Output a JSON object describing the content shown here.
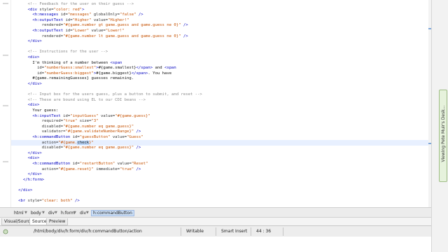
{
  "editor": {
    "lines": [
      {
        "segments": [
          {
            "t": "comment",
            "v": "<!-- Feedback for the user on their guess -->"
          }
        ],
        "indent": 7
      },
      {
        "segments": [
          {
            "t": "tag",
            "v": "<div"
          },
          {
            "t": "attr",
            "v": " style="
          },
          {
            "t": "str",
            "v": "\"color: red\""
          },
          {
            "t": "tag",
            "v": ">"
          }
        ],
        "indent": 7
      },
      {
        "segments": [
          {
            "t": "tag",
            "v": "<h:messages"
          },
          {
            "t": "attr",
            "v": " id="
          },
          {
            "t": "str",
            "v": "\"messages\""
          },
          {
            "t": "attr",
            "v": " globalOnly="
          },
          {
            "t": "str",
            "v": "\"false\""
          },
          {
            "t": "tag",
            "v": " />"
          }
        ],
        "indent": 9
      },
      {
        "segments": [
          {
            "t": "tag",
            "v": "<h:outputText"
          },
          {
            "t": "attr",
            "v": " id="
          },
          {
            "t": "str",
            "v": "\"Higher\""
          },
          {
            "t": "attr",
            "v": " value="
          },
          {
            "t": "str",
            "v": "\"Higher!\""
          }
        ],
        "indent": 9
      },
      {
        "segments": [
          {
            "t": "attr",
            "v": "rendered="
          },
          {
            "t": "str",
            "v": "\"#{game.number gt game.guess and game.guess ne 0}\""
          },
          {
            "t": "tag",
            "v": " />"
          }
        ],
        "indent": 13
      },
      {
        "segments": [
          {
            "t": "tag",
            "v": "<h:outputText"
          },
          {
            "t": "attr",
            "v": " id="
          },
          {
            "t": "str",
            "v": "\"Lower\""
          },
          {
            "t": "attr",
            "v": " value="
          },
          {
            "t": "str",
            "v": "\"Lower!\""
          }
        ],
        "indent": 9
      },
      {
        "segments": [
          {
            "t": "attr",
            "v": "rendered="
          },
          {
            "t": "str",
            "v": "\"#{game.number lt game.guess and game.guess ne 0}\""
          },
          {
            "t": "tag",
            "v": " />"
          }
        ],
        "indent": 13
      },
      {
        "segments": [
          {
            "t": "tag",
            "v": "</div>"
          }
        ],
        "indent": 7
      },
      {
        "segments": [],
        "indent": 0
      },
      {
        "segments": [
          {
            "t": "comment",
            "v": "<!-- Instructions for the user -->"
          }
        ],
        "indent": 7
      },
      {
        "segments": [
          {
            "t": "tag",
            "v": "<div>"
          }
        ],
        "indent": 7
      },
      {
        "segments": [
          {
            "t": "text",
            "v": "I'm thinking of a number between "
          },
          {
            "t": "tag",
            "v": "<span"
          }
        ],
        "indent": 9
      },
      {
        "segments": [
          {
            "t": "attr",
            "v": "id="
          },
          {
            "t": "str",
            "v": "\"numberGuess:smallest\""
          },
          {
            "t": "tag",
            "v": ">"
          },
          {
            "t": "text",
            "v": "#{game.smallest}"
          },
          {
            "t": "tag",
            "v": "</span>"
          },
          {
            "t": "text",
            "v": " and "
          },
          {
            "t": "tag",
            "v": "<span"
          }
        ],
        "indent": 11
      },
      {
        "segments": [
          {
            "t": "attr",
            "v": "id="
          },
          {
            "t": "str",
            "v": "\"numberGuess:biggest\""
          },
          {
            "t": "tag",
            "v": ">"
          },
          {
            "t": "text",
            "v": "#{game.biggest}"
          },
          {
            "t": "tag",
            "v": "</span>"
          },
          {
            "t": "text",
            "v": ". You have"
          }
        ],
        "indent": 11
      },
      {
        "segments": [
          {
            "t": "text",
            "v": "#{game.remainingGuesses} guesses remaining."
          }
        ],
        "indent": 9
      },
      {
        "segments": [
          {
            "t": "tag",
            "v": "</div>"
          }
        ],
        "indent": 7
      },
      {
        "segments": [],
        "indent": 0
      },
      {
        "segments": [
          {
            "t": "comment",
            "v": "<!-- Input box for the users guess, plus a button to submit, and reset -->"
          }
        ],
        "indent": 7
      },
      {
        "segments": [
          {
            "t": "comment",
            "v": "<!-- These are bound using EL to our CDI beans -->"
          }
        ],
        "indent": 7
      },
      {
        "segments": [
          {
            "t": "tag",
            "v": "<div>"
          }
        ],
        "indent": 7
      },
      {
        "segments": [
          {
            "t": "text",
            "v": "Your guess:"
          }
        ],
        "indent": 9
      },
      {
        "segments": [
          {
            "t": "tag",
            "v": "<h:inputText"
          },
          {
            "t": "attr",
            "v": " id="
          },
          {
            "t": "str",
            "v": "\"inputGuess\""
          },
          {
            "t": "attr",
            "v": " value="
          },
          {
            "t": "str",
            "v": "\"#{game.guess}\""
          }
        ],
        "indent": 9
      },
      {
        "segments": [
          {
            "t": "attr",
            "v": "required="
          },
          {
            "t": "str",
            "v": "\"true\""
          },
          {
            "t": "attr",
            "v": " size="
          },
          {
            "t": "str",
            "v": "\"3\""
          }
        ],
        "indent": 13
      },
      {
        "segments": [
          {
            "t": "attr",
            "v": "disabled="
          },
          {
            "t": "str",
            "v": "\"#{game.number eq game.guess}\""
          }
        ],
        "indent": 13
      },
      {
        "segments": [
          {
            "t": "attr",
            "v": "validator="
          },
          {
            "t": "str",
            "v": "\"#{game.validateNumberRange}\""
          },
          {
            "t": "tag",
            "v": " />"
          }
        ],
        "indent": 13
      },
      {
        "segments": [
          {
            "t": "tag",
            "v": "<h:commandButton"
          },
          {
            "t": "attr",
            "v": " id="
          },
          {
            "t": "str",
            "v": "\"guessButton\""
          },
          {
            "t": "attr",
            "v": " value="
          },
          {
            "t": "str",
            "v": "\"Guess\""
          }
        ],
        "indent": 9
      },
      {
        "segments": [
          {
            "t": "attr",
            "v": "action="
          },
          {
            "t": "str",
            "v": "\"#{game."
          },
          {
            "t": "hl",
            "v": "check"
          },
          {
            "t": "str",
            "v": "}\""
          }
        ],
        "indent": 13,
        "current": true
      },
      {
        "segments": [
          {
            "t": "attr",
            "v": "disabled="
          },
          {
            "t": "str",
            "v": "\"#{game.number eq game.guess}\""
          },
          {
            "t": "tag",
            "v": " />"
          }
        ],
        "indent": 13
      },
      {
        "segments": [
          {
            "t": "tag",
            "v": "</div>"
          }
        ],
        "indent": 7
      },
      {
        "segments": [
          {
            "t": "tag",
            "v": "<div>"
          }
        ],
        "indent": 7
      },
      {
        "segments": [
          {
            "t": "tag",
            "v": "<h:commandButton"
          },
          {
            "t": "attr",
            "v": " id="
          },
          {
            "t": "str",
            "v": "\"restartButton\""
          },
          {
            "t": "attr",
            "v": " value="
          },
          {
            "t": "str",
            "v": "\"Reset\""
          }
        ],
        "indent": 9
      },
      {
        "segments": [
          {
            "t": "attr",
            "v": "action="
          },
          {
            "t": "str",
            "v": "\"#{game.reset}\""
          },
          {
            "t": "attr",
            "v": " immediate="
          },
          {
            "t": "str",
            "v": "\"true\""
          },
          {
            "t": "tag",
            "v": " />"
          }
        ],
        "indent": 13
      },
      {
        "segments": [
          {
            "t": "tag",
            "v": "</div>"
          }
        ],
        "indent": 7
      },
      {
        "segments": [
          {
            "t": "tag",
            "v": "</h:form>"
          }
        ],
        "indent": 5
      },
      {
        "segments": [],
        "indent": 0
      },
      {
        "segments": [
          {
            "t": "tag",
            "v": "</div>"
          }
        ],
        "indent": 3
      },
      {
        "segments": [],
        "indent": 0
      },
      {
        "segments": [
          {
            "t": "tag",
            "v": "<br"
          },
          {
            "t": "attr",
            "v": " style="
          },
          {
            "t": "str",
            "v": "\"clear: both\""
          },
          {
            "t": "tag",
            "v": " />"
          }
        ],
        "indent": 3
      }
    ]
  },
  "side_tab": {
    "label": "Viewing Pete Muir's Desk..."
  },
  "breadcrumbs": {
    "items": [
      "html",
      "body",
      "div",
      "h:form",
      "div",
      "h:commandButton"
    ]
  },
  "view_tabs": {
    "items": [
      "Visual/Source",
      "Source",
      "Preview"
    ],
    "active_index": 1
  },
  "status": {
    "path": "/html/body/div/h:form/div/h:commandButton/action",
    "mode": "Writable",
    "insert": "Smart Insert",
    "position": "44 : 36"
  }
}
